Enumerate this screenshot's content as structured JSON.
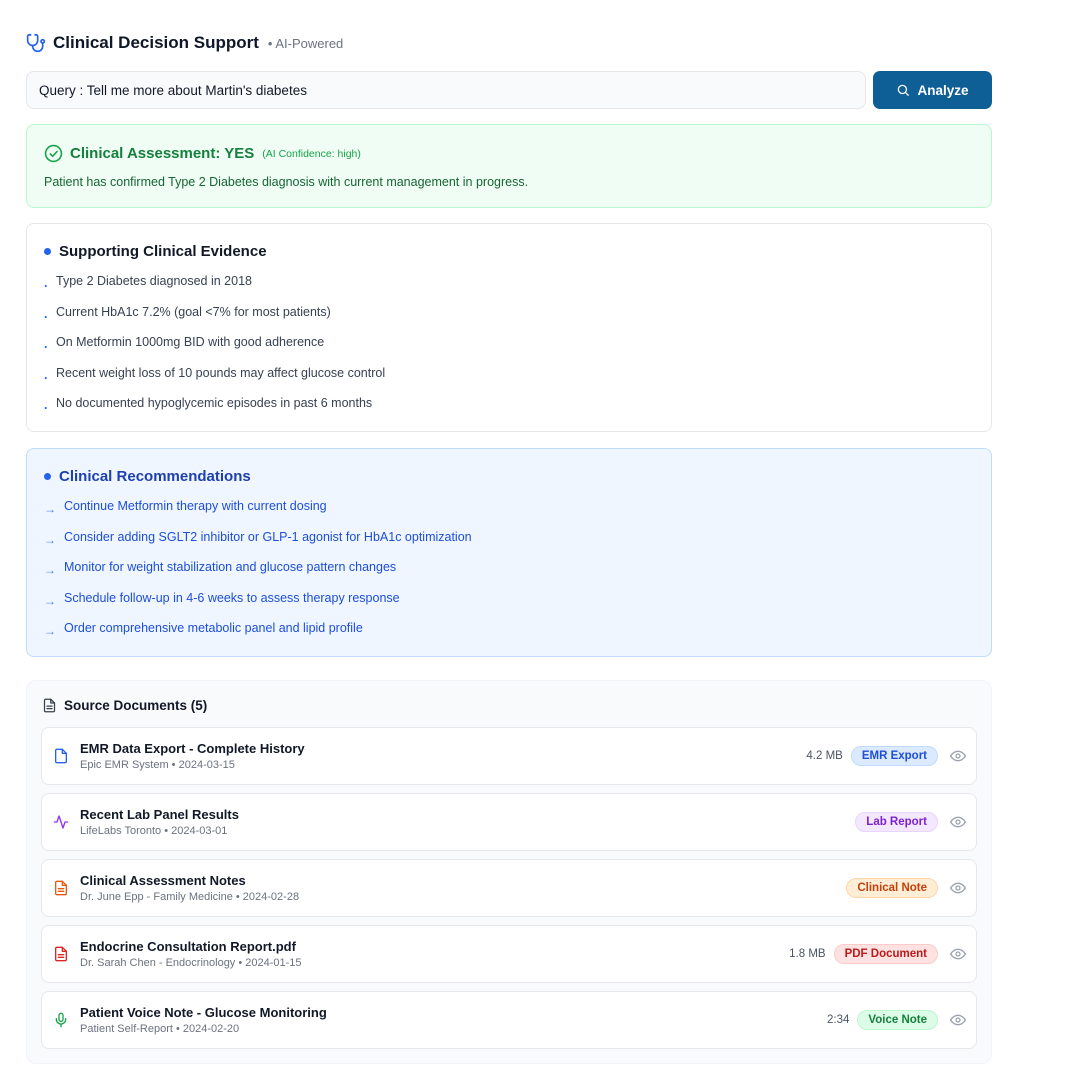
{
  "header": {
    "title": "Clinical Decision Support",
    "subtitle": "• AI-Powered",
    "icon": "stethoscope-icon"
  },
  "query": {
    "value": "Query : Tell me more about Martin's diabetes",
    "button_label": "Analyze"
  },
  "assessment": {
    "label": "Clinical Assessment: YES",
    "confidence": "(AI Confidence: high)",
    "description": "Patient has confirmed Type 2 Diabetes diagnosis with current management in progress.",
    "color": "#15803d"
  },
  "evidence": {
    "title": "Supporting Clinical Evidence",
    "bullet": ".",
    "items": [
      "Type 2 Diabetes diagnosed in 2018",
      "Current HbA1c 7.2% (goal <7% for most patients)",
      "On Metformin 1000mg BID with good adherence",
      "Recent weight loss of 10 pounds may affect glucose control",
      "No documented hypoglycemic episodes in past 6 months"
    ]
  },
  "recommendations": {
    "title": "Clinical Recommendations",
    "arrow": "→",
    "items": [
      "Continue Metformin therapy with current dosing",
      "Consider adding SGLT2 inhibitor or GLP-1 agonist for HbA1c optimization",
      "Monitor for weight stabilization and glucose pattern changes",
      "Schedule follow-up in 4-6 weeks to assess therapy response",
      "Order comprehensive metabolic panel and lipid profile"
    ]
  },
  "sources": {
    "title": "Source Documents (5)",
    "docs": [
      {
        "name": "EMR Data Export - Complete History",
        "meta": "Epic EMR System • 2024-03-15",
        "size": "4.2 MB",
        "badge": "EMR Export",
        "icon": "file-icon"
      },
      {
        "name": "Recent Lab Panel Results",
        "meta": "LifeLabs Toronto • 2024-03-01",
        "size": "",
        "badge": "Lab Report",
        "icon": "activity-icon"
      },
      {
        "name": "Clinical Assessment Notes",
        "meta": "Dr. June Epp - Family Medicine • 2024-02-28",
        "size": "",
        "badge": "Clinical Note",
        "icon": "file-text-icon"
      },
      {
        "name": "Endocrine Consultation Report.pdf",
        "meta": "Dr. Sarah Chen - Endocrinology • 2024-01-15",
        "size": "1.8 MB",
        "badge": "PDF Document",
        "icon": "pdf-file-icon"
      },
      {
        "name": "Patient Voice Note - Glucose Monitoring",
        "meta": "Patient Self-Report • 2024-02-20",
        "size": "2:34",
        "badge": "Voice Note",
        "icon": "microphone-icon"
      }
    ]
  }
}
